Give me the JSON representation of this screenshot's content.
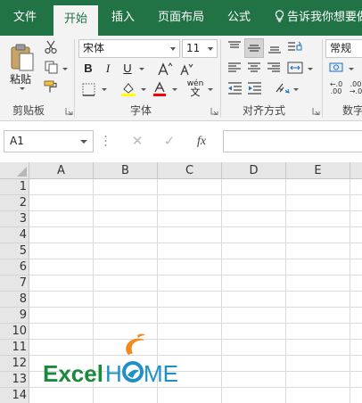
{
  "tabs": [
    {
      "label": "文件",
      "active": false
    },
    {
      "label": "开始",
      "active": true
    },
    {
      "label": "插入",
      "active": false
    },
    {
      "label": "页面布局",
      "active": false
    },
    {
      "label": "公式",
      "active": false
    }
  ],
  "tell_me": "告诉我你想要做",
  "clipboard": {
    "paste_label": "粘贴",
    "group_label": "剪贴板"
  },
  "font": {
    "name": "宋体",
    "size": "11",
    "group_label": "字体",
    "bold": "B",
    "italic": "I",
    "underline": "U",
    "phonetic": "wén"
  },
  "alignment": {
    "group_label": "对齐方式"
  },
  "number": {
    "format": "常规",
    "group_label": "数字"
  },
  "formula_bar": {
    "name_box": "A1",
    "fx": "fx"
  },
  "columns": [
    "A",
    "B",
    "C",
    "D",
    "E"
  ],
  "rows": [
    "1",
    "2",
    "3",
    "4",
    "5",
    "6",
    "7",
    "8",
    "9",
    "10",
    "11",
    "12",
    "13",
    "14"
  ],
  "logo_text": {
    "excel": "Excel",
    "home_h": "H",
    "home_me": "ME"
  },
  "colors": {
    "accent": "#217346",
    "logo_green": "#1a8a3c",
    "logo_blue": "#1e90c8",
    "logo_orange": "#f08a1c"
  }
}
